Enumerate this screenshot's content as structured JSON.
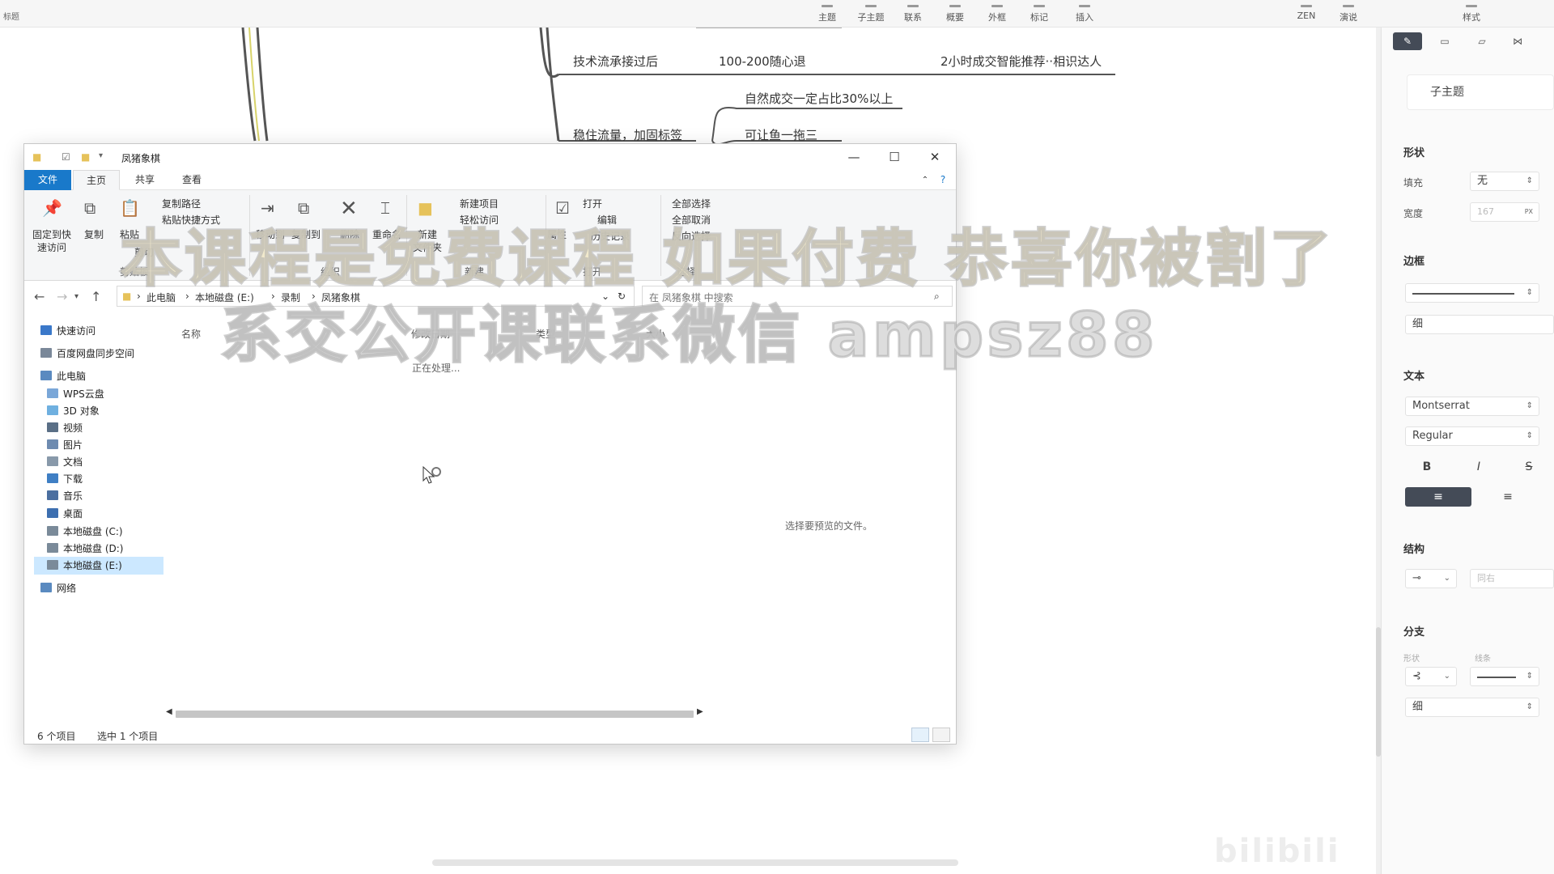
{
  "topbar": {
    "corner_label": "标题",
    "items": [
      "主题",
      "子主题",
      "联系",
      "概要",
      "外框",
      "标记",
      "插入",
      "ZEN",
      "演说",
      "样式"
    ]
  },
  "mindmap": {
    "row1_left": "技术流承接过后",
    "row1_mid": "100-200随心退",
    "row1_right": "2小时成交智能推荐··相识达人",
    "row2_child1": "自然成交一定占比30%以上",
    "row2_left": "稳住流量，加固标签",
    "row2_child2": "可让鱼一拖三"
  },
  "panel": {
    "topic_type": "子主题",
    "shape_title": "形状",
    "fill_label": "填充",
    "fill_value": "无",
    "width_label": "宽度",
    "width_value": "167",
    "width_unit": "PX",
    "border_title": "边框",
    "border_weight": "细",
    "text_title": "文本",
    "font_family": "Montserrat",
    "font_style": "Regular",
    "bold": "B",
    "italic": "I",
    "strike": "S",
    "structure_title": "结构",
    "structure_value": "同右",
    "branch_title": "分支",
    "branch_shape_label": "形状",
    "branch_line_label": "线条",
    "branch_weight": "细"
  },
  "explorer": {
    "title": "凤猪象棋",
    "tabs": [
      "文件",
      "主页",
      "共享",
      "查看"
    ],
    "ribbon": {
      "pin": "固定到快\n速访问",
      "pin_line1": "固定到快",
      "pin_line2": "速访问",
      "copy": "复制",
      "paste": "粘贴",
      "copy_path": "复制路径",
      "paste_shortcut": "粘贴快捷方式",
      "cut": "剪切",
      "clipboard_group": "剪贴板",
      "move_to": "移动到",
      "copy_to": "复制到",
      "delete": "删除",
      "rename": "重命名",
      "organize_group": "组织",
      "new_folder_line1": "新建",
      "new_folder_line2": "文件夹",
      "new_item": "新建项目",
      "easy_access": "轻松访问",
      "new_group": "新建",
      "properties": "属性",
      "open": "打开",
      "edit": "编辑",
      "history": "历史记录",
      "open_group": "打开",
      "select_all": "全部选择",
      "select_none": "全部取消",
      "invert": "反向选择",
      "select_group": "选择"
    },
    "breadcrumb": [
      "此电脑",
      "本地磁盘 (E:)",
      "录制",
      "凤猪象棋"
    ],
    "search_placeholder": "在 凤猪象棋 中搜索",
    "columns": [
      "名称",
      "修改日期",
      "类型",
      "大小"
    ],
    "processing": "正在处理...",
    "preview_message": "选择要预览的文件。",
    "nav": [
      {
        "label": "快速访问",
        "color": "#3a78c9"
      },
      {
        "label": "百度网盘同步空间",
        "color": "#7a8899"
      },
      {
        "label": "此电脑",
        "color": "#5a8ac0"
      },
      {
        "label": "WPS云盘",
        "color": "#7aa7d8"
      },
      {
        "label": "3D 对象",
        "color": "#6fb0e0"
      },
      {
        "label": "视频",
        "color": "#5a6f86"
      },
      {
        "label": "图片",
        "color": "#6e8bb0"
      },
      {
        "label": "文档",
        "color": "#8899aa"
      },
      {
        "label": "下载",
        "color": "#3f7fc4"
      },
      {
        "label": "音乐",
        "color": "#4b6fa0"
      },
      {
        "label": "桌面",
        "color": "#3d6fb0"
      },
      {
        "label": "本地磁盘 (C:)",
        "color": "#7a8a99"
      },
      {
        "label": "本地磁盘 (D:)",
        "color": "#7a8a99"
      },
      {
        "label": "本地磁盘 (E:)",
        "color": "#7a8a99"
      },
      {
        "label": "网络",
        "color": "#5a8ac0"
      }
    ],
    "status_items": "6 个项目",
    "status_selected": "选中 1 个项目"
  },
  "overlay": {
    "line1": "本课程是免费课程 如果付费 恭喜你被割了",
    "line2": "系交公开课联系微信 ampsz88"
  },
  "watermark": "bilibili"
}
